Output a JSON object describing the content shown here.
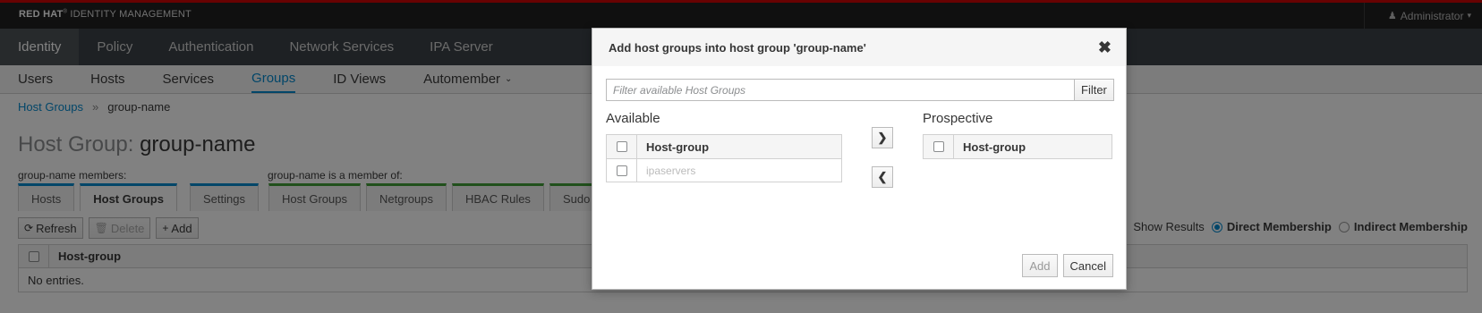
{
  "banner": {
    "brand_bold": "RED HAT",
    "brand_rest": "IDENTITY MANAGEMENT",
    "user": "Administrator",
    "user_icon": "user-icon",
    "accent": "#cc0000"
  },
  "mainnav": [
    "Identity",
    "Policy",
    "Authentication",
    "Network Services",
    "IPA Server"
  ],
  "subnav": [
    "Users",
    "Hosts",
    "Services",
    "Groups",
    "ID Views",
    "Automember"
  ],
  "breadcrumb": {
    "parent": "Host Groups",
    "separator": "»",
    "current": "group-name"
  },
  "page": {
    "title_prefix": "Host Group:",
    "title_name": "group-name",
    "members_label": "group-name members:",
    "memberof_label": "group-name is a member of:"
  },
  "member_tabs": [
    "Hosts",
    "Host Groups",
    "Settings"
  ],
  "memberof_tabs": [
    "Host Groups",
    "Netgroups",
    "HBAC Rules",
    "Sudo Ru"
  ],
  "toolbar": {
    "refresh": "Refresh",
    "delete": "Delete",
    "add": "Add"
  },
  "show_results": {
    "label": "Show Results",
    "direct": "Direct Membership",
    "indirect": "Indirect Membership"
  },
  "table": {
    "column": "Host-group",
    "empty": "No entries."
  },
  "dialog": {
    "title": "Add host groups into host group 'group-name'",
    "filter_placeholder": "Filter available Host Groups",
    "filter_button": "Filter",
    "available_label": "Available",
    "prospective_label": "Prospective",
    "column": "Host-group",
    "available_items": [
      "ipaservers"
    ],
    "add_button": "Add",
    "cancel_button": "Cancel"
  }
}
